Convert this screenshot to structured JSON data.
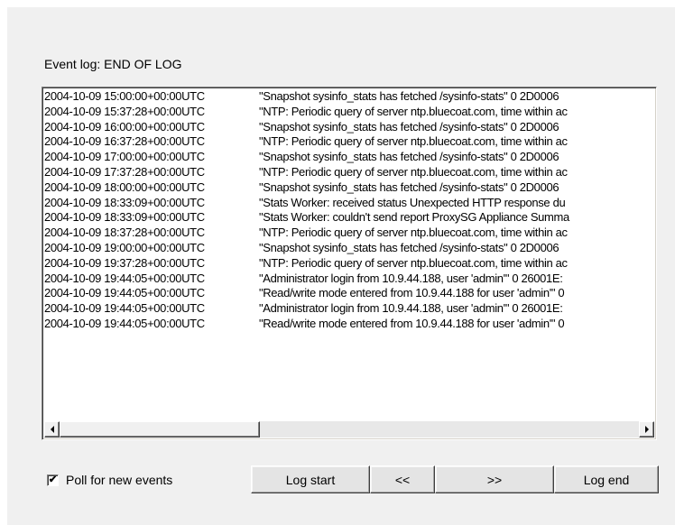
{
  "event_log": {
    "label": "Event log: END OF LOG",
    "rows": [
      {
        "timestamp": "2004-10-09 15:00:00+00:00UTC",
        "message": "\"Snapshot sysinfo_stats has fetched /sysinfo-stats\"  0 2D0006"
      },
      {
        "timestamp": "2004-10-09 15:37:28+00:00UTC",
        "message": "\"NTP: Periodic query of server ntp.bluecoat.com, time within ac"
      },
      {
        "timestamp": "2004-10-09 16:00:00+00:00UTC",
        "message": "\"Snapshot sysinfo_stats has fetched /sysinfo-stats\"  0 2D0006"
      },
      {
        "timestamp": "2004-10-09 16:37:28+00:00UTC",
        "message": "\"NTP: Periodic query of server ntp.bluecoat.com, time within ac"
      },
      {
        "timestamp": "2004-10-09 17:00:00+00:00UTC",
        "message": "\"Snapshot sysinfo_stats has fetched /sysinfo-stats\"  0 2D0006"
      },
      {
        "timestamp": "2004-10-09 17:37:28+00:00UTC",
        "message": "\"NTP: Periodic query of server ntp.bluecoat.com, time within ac"
      },
      {
        "timestamp": "2004-10-09 18:00:00+00:00UTC",
        "message": "\"Snapshot sysinfo_stats has fetched /sysinfo-stats\"  0 2D0006"
      },
      {
        "timestamp": "2004-10-09 18:33:09+00:00UTC",
        "message": "\"Stats Worker: received status Unexpected HTTP response du"
      },
      {
        "timestamp": "2004-10-09 18:33:09+00:00UTC",
        "message": "\"Stats Worker: couldn't send report ProxySG Appliance Summa"
      },
      {
        "timestamp": "2004-10-09 18:37:28+00:00UTC",
        "message": "\"NTP: Periodic query of server ntp.bluecoat.com, time within ac"
      },
      {
        "timestamp": "2004-10-09 19:00:00+00:00UTC",
        "message": "\"Snapshot sysinfo_stats has fetched /sysinfo-stats\"  0 2D0006"
      },
      {
        "timestamp": "2004-10-09 19:37:28+00:00UTC",
        "message": "\"NTP: Periodic query of server ntp.bluecoat.com, time within ac"
      },
      {
        "timestamp": "2004-10-09 19:44:05+00:00UTC",
        "message": "\"Administrator login from 10.9.44.188, user 'admin'\"  0 26001E:"
      },
      {
        "timestamp": "2004-10-09 19:44:05+00:00UTC",
        "message": "\"Read/write mode entered from 10.9.44.188 for user 'admin'\"  0"
      },
      {
        "timestamp": "2004-10-09 19:44:05+00:00UTC",
        "message": "\"Administrator login from 10.9.44.188, user 'admin'\"  0 26001E:"
      },
      {
        "timestamp": "2004-10-09 19:44:05+00:00UTC",
        "message": "\"Read/write mode entered from 10.9.44.188 for user 'admin'\"  0"
      }
    ]
  },
  "controls": {
    "poll_label": "Poll for new events",
    "poll_checked": true,
    "poll_mark": "✔",
    "log_start": "Log start",
    "prev": "<<",
    "next": ">>",
    "log_end": "Log end"
  },
  "icons": {
    "scroll_left": "triangle-left",
    "scroll_right": "triangle-right"
  }
}
